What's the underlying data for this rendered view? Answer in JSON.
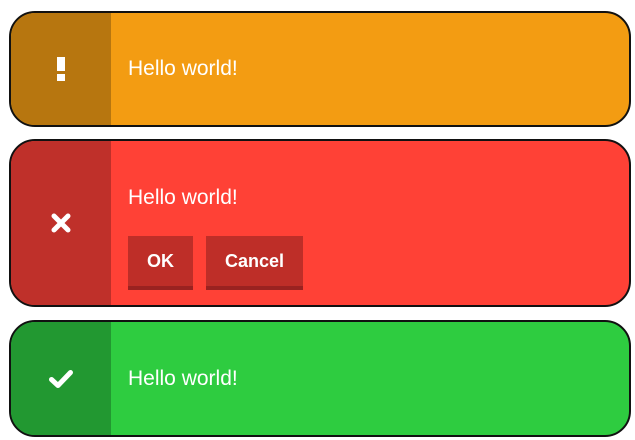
{
  "colors": {
    "warning_body": "#f39c12",
    "warning_icon": "#b7760f",
    "error_body": "#ff4136",
    "error_icon": "#bf302a",
    "error_button": "#be2e28",
    "success_body": "#2ecc40",
    "success_icon": "#229831"
  },
  "notifications": [
    {
      "type": "warning",
      "icon": "exclamation-icon",
      "message": "Hello world!"
    },
    {
      "type": "error",
      "icon": "times-icon",
      "message": "Hello world!",
      "buttons": [
        {
          "label": "OK"
        },
        {
          "label": "Cancel"
        }
      ]
    },
    {
      "type": "success",
      "icon": "check-icon",
      "message": "Hello world!"
    }
  ]
}
